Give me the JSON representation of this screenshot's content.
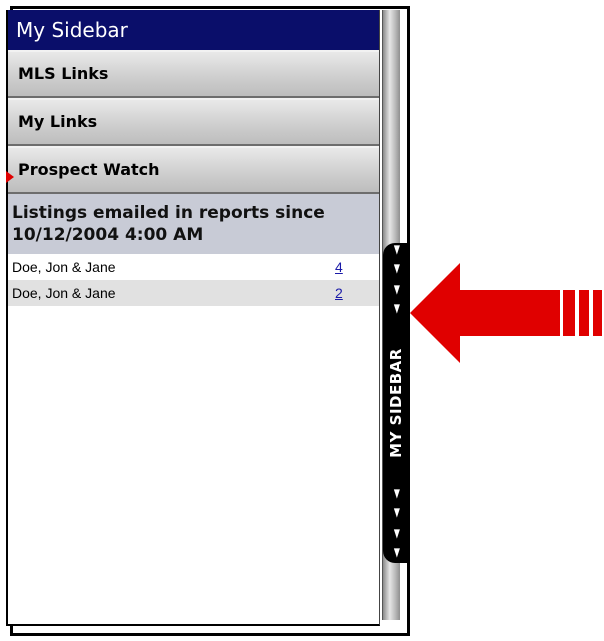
{
  "sidebar": {
    "title": "My Sidebar",
    "nav": [
      {
        "label": "MLS Links"
      },
      {
        "label": "My Links"
      },
      {
        "label": "Prospect Watch"
      }
    ],
    "report": {
      "header": "Listings emailed in reports since 10/12/2004 4:00 AM",
      "rows": [
        {
          "name": "Doe, Jon & Jane",
          "count": "4"
        },
        {
          "name": "Doe, Jon & Jane",
          "count": "2"
        }
      ]
    }
  },
  "tab": {
    "label": "MY SIDEBAR",
    "arrow_glyph": "◄ ◄"
  },
  "colors": {
    "title_bar": "#0a0e6a",
    "callout_arrow": "#e00000",
    "tab_background": "#000000"
  },
  "icons": {
    "callout": "red-pointer-arrow-icon",
    "tab_arrows": "double-left-arrow-icon"
  }
}
